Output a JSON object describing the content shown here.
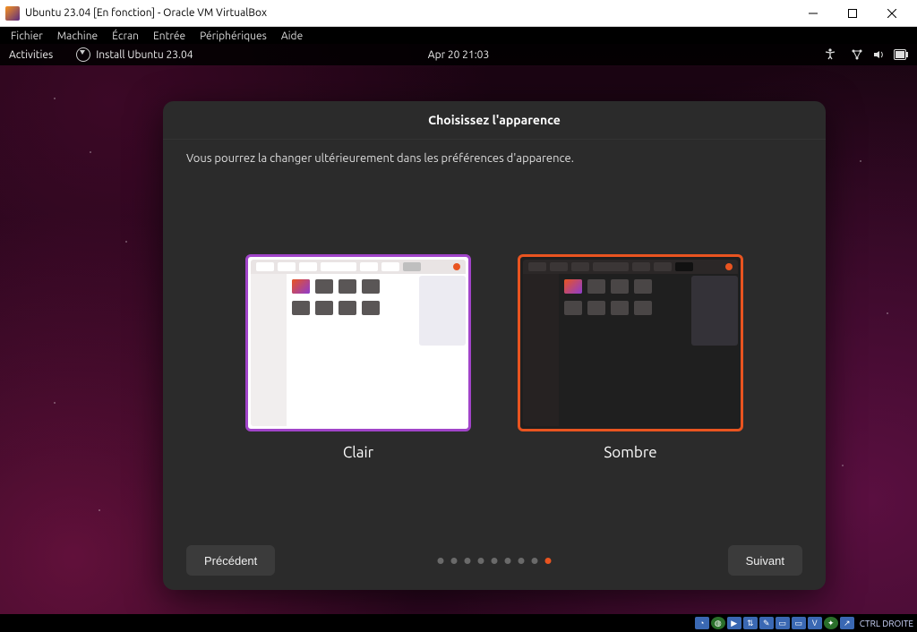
{
  "vbox": {
    "title": "Ubuntu 23.04 [En fonction] - Oracle VM VirtualBox",
    "menu": [
      "Fichier",
      "Machine",
      "Écran",
      "Entrée",
      "Périphériques",
      "Aide"
    ],
    "hostkey": "CTRL DROITE"
  },
  "topbar": {
    "activities": "Activities",
    "install": "Install Ubuntu 23.04",
    "clock": "Apr 20  21:03"
  },
  "installer": {
    "title": "Choisissez l'apparence",
    "subtitle": "Vous pourrez la changer ultérieurement dans les préférences d'apparence.",
    "options": {
      "light": "Clair",
      "dark": "Sombre"
    },
    "selected": "dark",
    "steps_total": 9,
    "step_current": 9,
    "back": "Précédent",
    "next": "Suivant"
  }
}
